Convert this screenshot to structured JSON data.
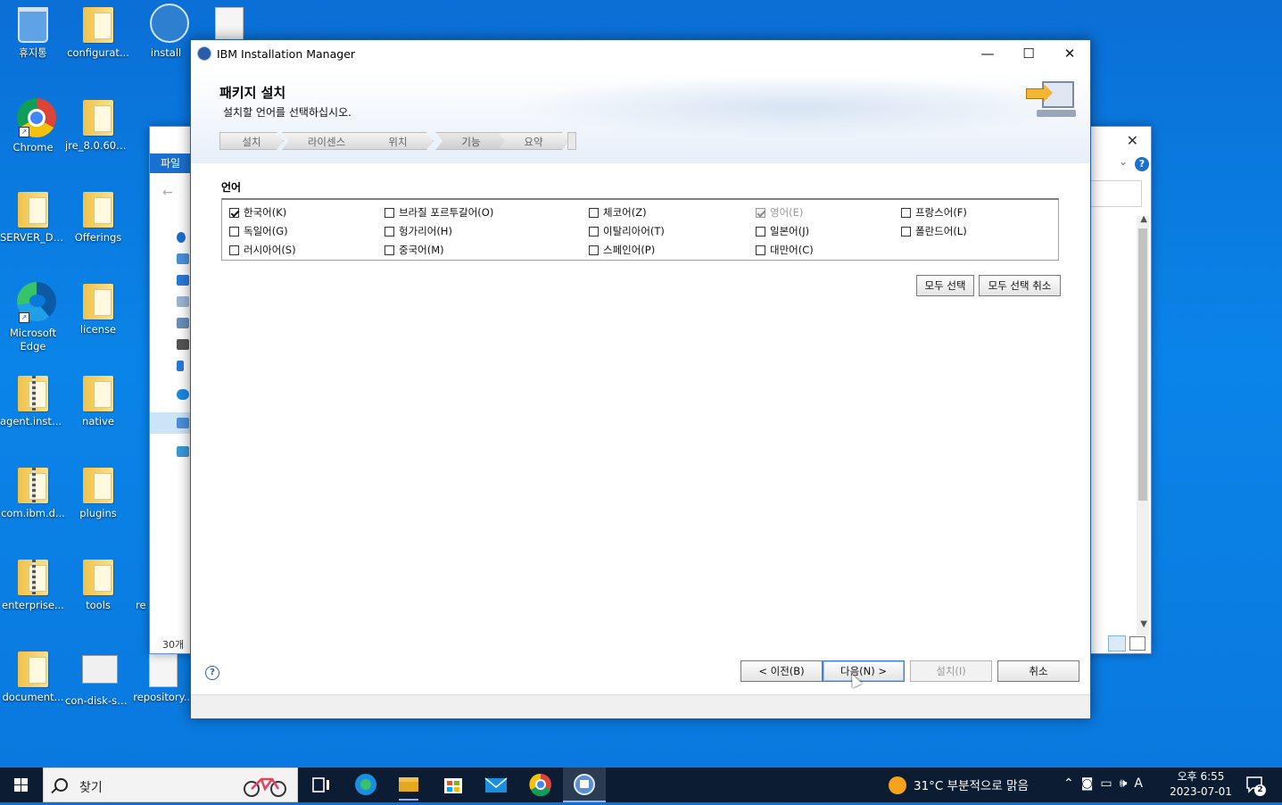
{
  "desktop": {
    "icons": [
      {
        "label": "휴지통"
      },
      {
        "label": "configurat..."
      },
      {
        "label": "install"
      },
      {
        "label": "Chrome"
      },
      {
        "label": "jre_8.0.603..."
      },
      {
        "label": "SERVER_DEC"
      },
      {
        "label": "Offerings"
      },
      {
        "label": "Microsoft Edge"
      },
      {
        "label": "license"
      },
      {
        "label": "agent.instal..."
      },
      {
        "label": "native"
      },
      {
        "label": "com.ibm.d..."
      },
      {
        "label": "plugins"
      },
      {
        "label": "enterprise..."
      },
      {
        "label": "tools"
      },
      {
        "label": "re"
      },
      {
        "label": "document..."
      },
      {
        "label": "con-disk-se..."
      },
      {
        "label": "repository..."
      }
    ]
  },
  "explorer": {
    "ribbon_tab": "파일",
    "item_count": "30개"
  },
  "dialog": {
    "title": "IBM Installation Manager",
    "page_title": "패키지 설치",
    "page_subtitle": "설치할 언어를 선택하십시오.",
    "steps": [
      "설치",
      "라이센스",
      "위치",
      "기능",
      "요약"
    ],
    "current_step": "기능",
    "section_label": "언어",
    "languages": [
      {
        "label": "한국어(K)",
        "checked": true,
        "enabled": true
      },
      {
        "label": "브라질 포르투갈어(O)",
        "checked": false,
        "enabled": true
      },
      {
        "label": "체코어(Z)",
        "checked": false,
        "enabled": true
      },
      {
        "label": "영어(E)",
        "checked": true,
        "enabled": false
      },
      {
        "label": "프랑스어(F)",
        "checked": false,
        "enabled": true
      },
      {
        "label": "독일어(G)",
        "checked": false,
        "enabled": true
      },
      {
        "label": "헝가리어(H)",
        "checked": false,
        "enabled": true
      },
      {
        "label": "이탈리아어(T)",
        "checked": false,
        "enabled": true
      },
      {
        "label": "일본어(J)",
        "checked": false,
        "enabled": true
      },
      {
        "label": "폴란드어(L)",
        "checked": false,
        "enabled": true
      },
      {
        "label": "러시아어(S)",
        "checked": false,
        "enabled": true
      },
      {
        "label": "중국어(M)",
        "checked": false,
        "enabled": true
      },
      {
        "label": "스페인어(P)",
        "checked": false,
        "enabled": true
      },
      {
        "label": "대만어(C)",
        "checked": false,
        "enabled": true
      }
    ],
    "select_all": "모두 선택",
    "deselect_all": "모두 선택 취소",
    "back": "< 이전(B)",
    "next": "다음(N) >",
    "install": "설치(I)",
    "cancel": "취소",
    "help": "?"
  },
  "taskbar": {
    "search_placeholder": "찾기",
    "weather": "31°C  부분적으로 맑음",
    "ime": "A",
    "time": "오후 6:55",
    "date": "2023-07-01",
    "notification_count": "2"
  },
  "colors": {
    "desktop_blue": "#0a78de",
    "taskbar": "#0c1d33",
    "dialog_border": "#1f5fa8"
  }
}
